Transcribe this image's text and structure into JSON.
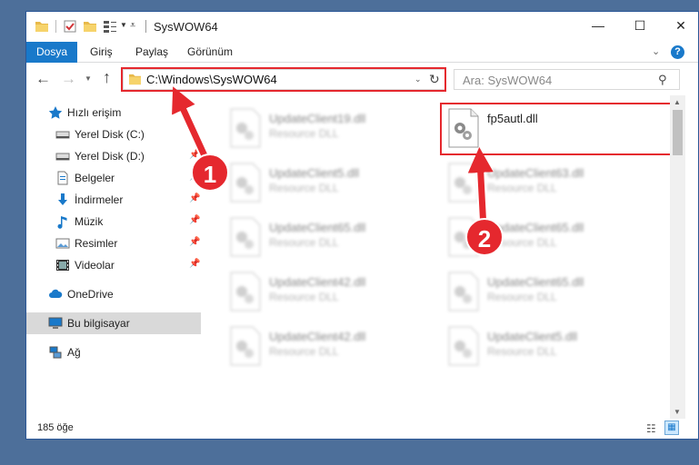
{
  "window": {
    "title": "SysWOW64",
    "min_label": "—",
    "max_label": "☐",
    "close_label": "✕"
  },
  "ribbon": {
    "file_tab": "Dosya",
    "tabs": [
      "Giriş",
      "Paylaş",
      "Görünüm"
    ],
    "help_label": "?"
  },
  "nav": {
    "address": "C:\\Windows\\SysWOW64",
    "search_placeholder": "Ara: SysWOW64"
  },
  "sidebar": {
    "items": [
      {
        "label": "Hızlı erişim",
        "icon": "star-icon",
        "pinned": false
      },
      {
        "label": "Yerel Disk (C:)",
        "icon": "drive-icon",
        "pinned": false
      },
      {
        "label": "Yerel Disk (D:)",
        "icon": "drive-icon",
        "pinned": true
      },
      {
        "label": "Belgeler",
        "icon": "documents-icon",
        "pinned": true
      },
      {
        "label": "İndirmeler",
        "icon": "download-icon",
        "pinned": true
      },
      {
        "label": "Müzik",
        "icon": "music-icon",
        "pinned": true
      },
      {
        "label": "Resimler",
        "icon": "pictures-icon",
        "pinned": true
      },
      {
        "label": "Videolar",
        "icon": "video-icon",
        "pinned": true
      },
      {
        "label": "OneDrive",
        "icon": "cloud-icon",
        "pinned": false
      },
      {
        "label": "Bu bilgisayar",
        "icon": "computer-icon",
        "pinned": false
      },
      {
        "label": "Ağ",
        "icon": "network-icon",
        "pinned": false
      }
    ]
  },
  "files": [
    {
      "name": "UpdateClient19.dll",
      "type": "Resource DLL",
      "highlighted": false
    },
    {
      "name": "fp5autl.dll",
      "type": "",
      "highlighted": true
    },
    {
      "name": "UpdateClient5.dll",
      "type": "Resource DLL",
      "highlighted": false
    },
    {
      "name": "UpdateClient63.dll",
      "type": "Resource DLL",
      "highlighted": false
    },
    {
      "name": "UpdateClient65.dll",
      "type": "Resource DLL",
      "highlighted": false
    },
    {
      "name": "UpdateClient65.dll",
      "type": "Resource DLL",
      "highlighted": false
    },
    {
      "name": "UpdateClient42.dll",
      "type": "Resource DLL",
      "highlighted": false
    },
    {
      "name": "UpdateClient65.dll",
      "type": "Resource DLL",
      "highlighted": false
    },
    {
      "name": "UpdateClient42.dll",
      "type": "Resource DLL",
      "highlighted": false
    },
    {
      "name": "UpdateClient5.dll",
      "type": "Resource DLL",
      "highlighted": false
    }
  ],
  "status": {
    "item_count": "185 öğe"
  },
  "annotations": {
    "step1": "1",
    "step2": "2"
  },
  "colors": {
    "accent": "#1979ca",
    "highlight_red": "#e5282e",
    "selection": "#cce8ff",
    "desktop": "#4d6f9a"
  }
}
